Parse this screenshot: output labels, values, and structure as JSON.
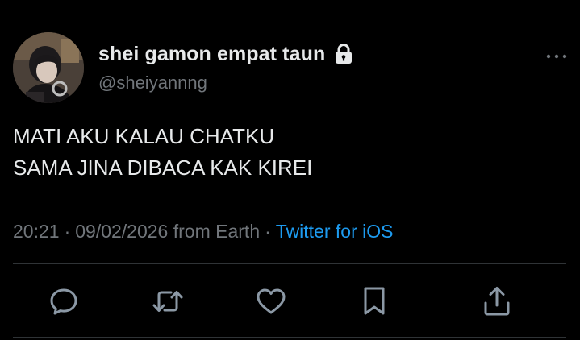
{
  "author": {
    "display_name": "shei gamon empat taun",
    "handle": "@sheiyannng",
    "protected": true,
    "avatar": "profile-photo"
  },
  "tweet": {
    "text_lines": [
      "MATI AKU KALAU CHATKU",
      "SAMA JINA DIBACA KAK KIREI"
    ],
    "time": "20:21",
    "date": "09/02/2026",
    "location": "from Earth",
    "separator": "·",
    "source": "Twitter for iOS"
  },
  "actions": [
    {
      "name": "reply",
      "icon": "speech-bubble-icon"
    },
    {
      "name": "retweet",
      "icon": "retweet-icon"
    },
    {
      "name": "like",
      "icon": "heart-icon"
    },
    {
      "name": "bookmark",
      "icon": "bookmark-icon"
    },
    {
      "name": "share",
      "icon": "share-upload-icon"
    }
  ],
  "colors": {
    "background": "#000000",
    "primary_text": "#e7e9ea",
    "secondary_text": "#71767b",
    "link": "#1d9bf0",
    "divider": "#2f3336"
  }
}
